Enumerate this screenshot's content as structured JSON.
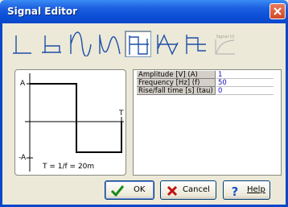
{
  "window": {
    "title": "Signal Editor"
  },
  "toolbar": {
    "tools": [
      {
        "icon": "step-signal-icon",
        "selected": false
      },
      {
        "icon": "pulse-signal-icon",
        "selected": false
      },
      {
        "icon": "sine-signal-icon",
        "selected": false
      },
      {
        "icon": "sine-inverted-signal-icon",
        "selected": false
      },
      {
        "icon": "square-signal-icon",
        "selected": true
      },
      {
        "icon": "triangle-signal-icon",
        "selected": false
      },
      {
        "icon": "pwm-signal-icon",
        "selected": false
      },
      {
        "icon": "custom-signal-icon",
        "selected": false,
        "label": "Signal (t)"
      }
    ]
  },
  "preview": {
    "amplitude_label_top": "A",
    "amplitude_label_bottom": "-A",
    "period_marker": "T",
    "formula": "T = 1/f = 20m"
  },
  "params": {
    "rows": [
      {
        "name": "Amplitude [V] (A)",
        "value": "1"
      },
      {
        "name": "Frequency [Hz] (f)",
        "value": "50"
      },
      {
        "name": "Rise/fall time [s] (tau)",
        "value": "0"
      }
    ]
  },
  "buttons": {
    "ok": "OK",
    "cancel": "Cancel",
    "help": "Help"
  },
  "colors": {
    "titlebar": "#0b47c9",
    "dialog_bg": "#ece9d8",
    "value_text": "#1010c0"
  }
}
